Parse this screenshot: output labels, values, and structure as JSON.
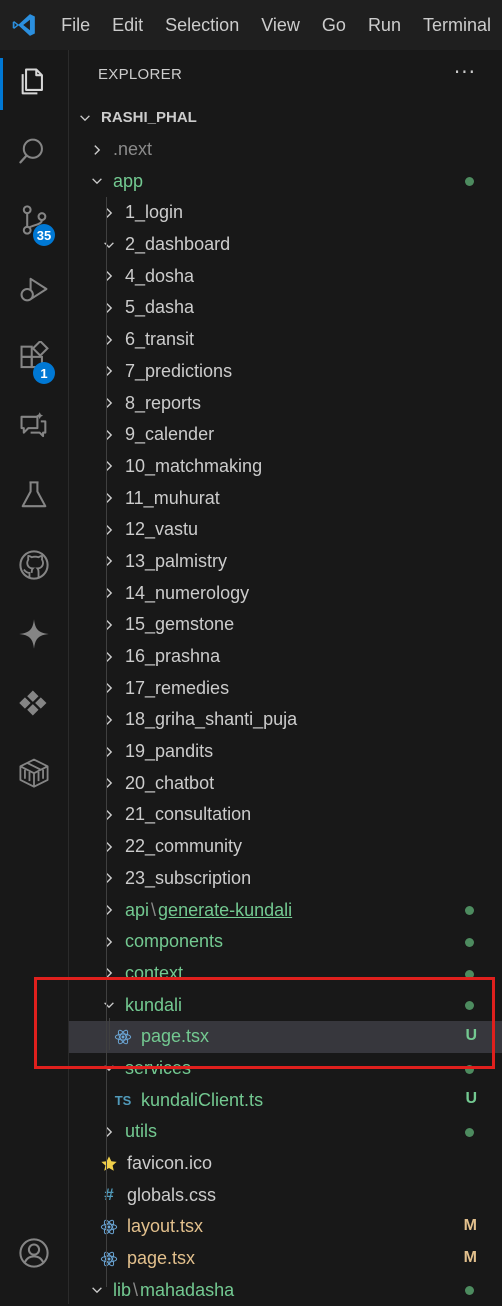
{
  "menu": [
    "File",
    "Edit",
    "Selection",
    "View",
    "Go",
    "Run",
    "Terminal"
  ],
  "activity_bar": {
    "items": [
      {
        "icon": "explorer-icon"
      },
      {
        "icon": "search-icon"
      },
      {
        "icon": "source-control-icon",
        "badge": "35"
      },
      {
        "icon": "run-debug-icon"
      },
      {
        "icon": "extensions-icon",
        "badge": "1"
      },
      {
        "icon": "chat-icon"
      },
      {
        "icon": "testing-icon"
      },
      {
        "icon": "github-icon"
      },
      {
        "icon": "copilot-icon"
      },
      {
        "icon": "remote-icon"
      },
      {
        "icon": "containers-icon"
      }
    ],
    "account_icon": "account-icon"
  },
  "explorer": {
    "title": "EXPLORER",
    "more": "···",
    "root": "RASHI_PHAL"
  },
  "tree": [
    {
      "label": ".next",
      "depth": 1,
      "kind": "folder",
      "open": false,
      "style": "grey"
    },
    {
      "label": "app",
      "depth": 1,
      "kind": "folder",
      "open": true,
      "style": "green",
      "dot": true
    },
    {
      "label": "1_login",
      "depth": 2,
      "kind": "folder",
      "open": false
    },
    {
      "label": "2_dashboard",
      "depth": 2,
      "kind": "folder",
      "open": true
    },
    {
      "label": "4_dosha",
      "depth": 2,
      "kind": "folder",
      "open": false
    },
    {
      "label": "5_dasha",
      "depth": 2,
      "kind": "folder",
      "open": false
    },
    {
      "label": "6_transit",
      "depth": 2,
      "kind": "folder",
      "open": false
    },
    {
      "label": "7_predictions",
      "depth": 2,
      "kind": "folder",
      "open": false
    },
    {
      "label": "8_reports",
      "depth": 2,
      "kind": "folder",
      "open": false
    },
    {
      "label": "9_calender",
      "depth": 2,
      "kind": "folder",
      "open": false
    },
    {
      "label": "10_matchmaking",
      "depth": 2,
      "kind": "folder",
      "open": false
    },
    {
      "label": "11_muhurat",
      "depth": 2,
      "kind": "folder",
      "open": false
    },
    {
      "label": "12_vastu",
      "depth": 2,
      "kind": "folder",
      "open": false
    },
    {
      "label": "13_palmistry",
      "depth": 2,
      "kind": "folder",
      "open": false
    },
    {
      "label": "14_numerology",
      "depth": 2,
      "kind": "folder",
      "open": false
    },
    {
      "label": "15_gemstone",
      "depth": 2,
      "kind": "folder",
      "open": false
    },
    {
      "label": "16_prashna",
      "depth": 2,
      "kind": "folder",
      "open": false
    },
    {
      "label": "17_remedies",
      "depth": 2,
      "kind": "folder",
      "open": false
    },
    {
      "label": "18_griha_shanti_puja",
      "depth": 2,
      "kind": "folder",
      "open": false
    },
    {
      "label": "19_pandits",
      "depth": 2,
      "kind": "folder",
      "open": false
    },
    {
      "label": "20_chatbot",
      "depth": 2,
      "kind": "folder",
      "open": false
    },
    {
      "label": "21_consultation",
      "depth": 2,
      "kind": "folder",
      "open": false
    },
    {
      "label": "22_community",
      "depth": 2,
      "kind": "folder",
      "open": false
    },
    {
      "label": "23_subscription",
      "depth": 2,
      "kind": "folder",
      "open": false
    },
    {
      "label": "api",
      "label2": "generate-kundali",
      "depth": 2,
      "kind": "folder",
      "open": false,
      "style": "green",
      "dot": true
    },
    {
      "label": "components",
      "depth": 2,
      "kind": "folder",
      "open": false,
      "style": "green",
      "dot": true
    },
    {
      "label": "context",
      "depth": 2,
      "kind": "folder",
      "open": false,
      "style": "green",
      "dot": true
    },
    {
      "label": "kundali",
      "depth": 2,
      "kind": "folder",
      "open": true,
      "style": "green",
      "dot": true
    },
    {
      "label": "page.tsx",
      "depth": 3,
      "kind": "react",
      "style": "green",
      "status": "U",
      "selected": true
    },
    {
      "label": "services",
      "depth": 2,
      "kind": "folder",
      "open": true,
      "style": "green",
      "dot": true
    },
    {
      "label": "kundaliClient.ts",
      "depth": 3,
      "kind": "ts",
      "style": "green",
      "status": "U"
    },
    {
      "label": "utils",
      "depth": 2,
      "kind": "folder",
      "open": false,
      "style": "green",
      "dot": true
    },
    {
      "label": "favicon.ico",
      "depth": 2,
      "kind": "star"
    },
    {
      "label": "globals.css",
      "depth": 2,
      "kind": "css"
    },
    {
      "label": "layout.tsx",
      "depth": 2,
      "kind": "react",
      "style": "mod",
      "status": "M"
    },
    {
      "label": "page.tsx",
      "depth": 2,
      "kind": "react",
      "style": "mod",
      "status": "M"
    },
    {
      "label": "lib",
      "label2": "mahadasha",
      "depth": 1,
      "kind": "folder",
      "open": true,
      "style": "green",
      "dot": true
    }
  ],
  "colors": {
    "accent": "#0078d4",
    "untracked": "#73c991",
    "modified": "#e2c08d",
    "highlight": "#e0201d"
  }
}
